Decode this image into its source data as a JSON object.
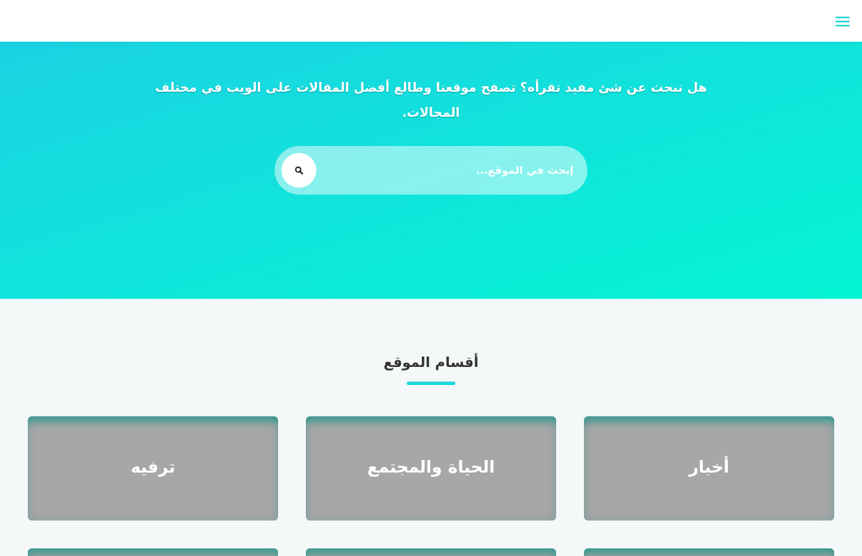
{
  "hero": {
    "tagline": "هل تبحث عن شئ مفيد تقرأه؟ تصفح موقعنا وطالع أفضل المقالات على الويب في مختلف المجالات.",
    "search": {
      "placeholder": "إبحث في الموقع..."
    }
  },
  "categories_section": {
    "title": "أقسام الموقع",
    "categories": [
      {
        "kind": "labeled",
        "title": "أخبار"
      },
      {
        "kind": "labeled",
        "title": "الحياة والمجتمع"
      },
      {
        "kind": "labeled",
        "title": "ترفيه"
      },
      {
        "kind": "cut_off"
      },
      {
        "kind": "cut_off"
      },
      {
        "kind": "cut_off"
      }
    ]
  }
}
